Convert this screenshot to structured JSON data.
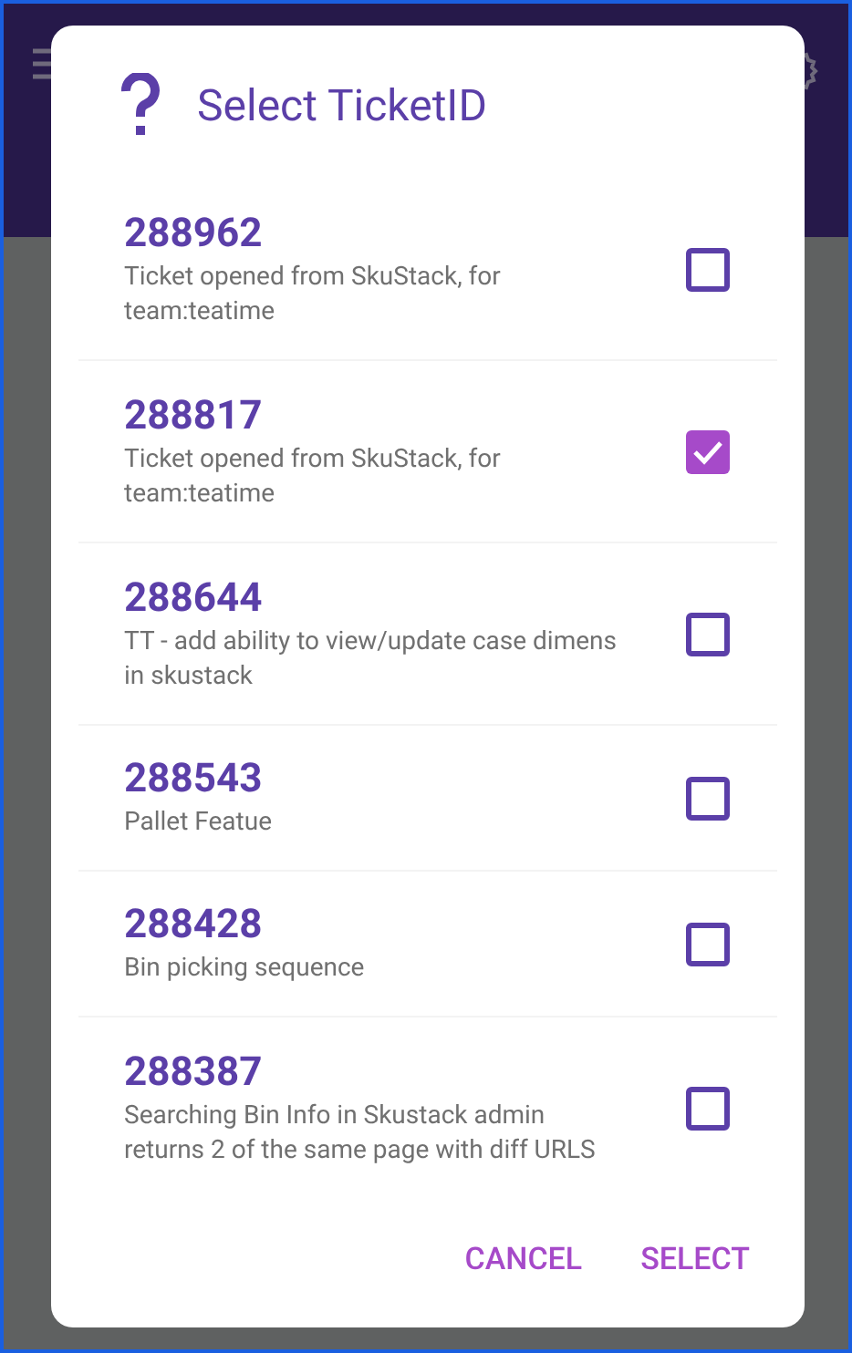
{
  "dialog": {
    "title": "Select TicketID",
    "tickets": [
      {
        "id": "288962",
        "description": "Ticket opened from SkuStack, for team:teatime",
        "checked": false
      },
      {
        "id": "288817",
        "description": "Ticket opened from SkuStack, for team:teatime",
        "checked": true
      },
      {
        "id": "288644",
        "description": "TT - add ability to view/update case dimens in skustack",
        "checked": false
      },
      {
        "id": "288543",
        "description": "Pallet Featue",
        "checked": false
      },
      {
        "id": "288428",
        "description": "Bin picking sequence",
        "checked": false
      },
      {
        "id": "288387",
        "description": "Searching Bin Info in Skustack admin returns 2 of the same page with diff URLS",
        "checked": false
      }
    ],
    "buttons": [
      "CANCEL",
      "SELECT"
    ]
  }
}
